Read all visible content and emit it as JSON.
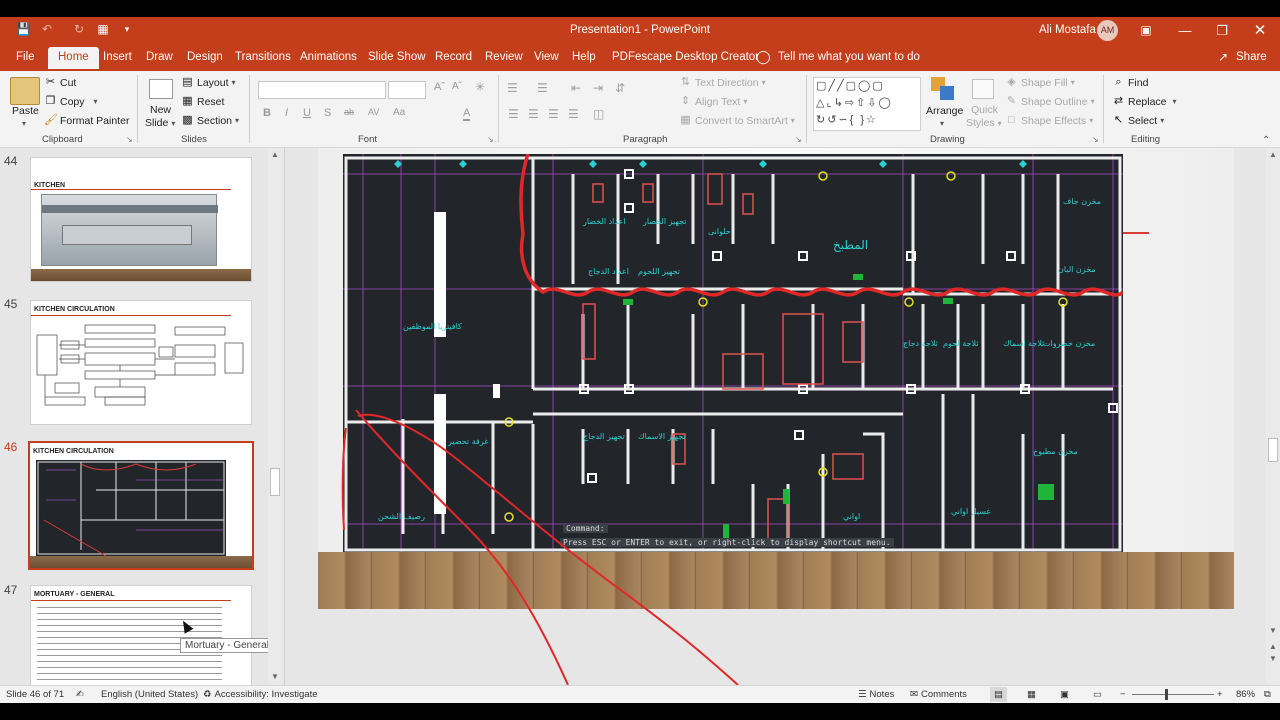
{
  "window": {
    "title": "Presentation1 - PowerPoint",
    "user_name": "Ali Mostafa",
    "user_initials": "AM"
  },
  "tabs": [
    "File",
    "Home",
    "Insert",
    "Draw",
    "Design",
    "Transitions",
    "Animations",
    "Slide Show",
    "Record",
    "Review",
    "View",
    "Help",
    "PDFescape Desktop Creator"
  ],
  "active_tab": "Home",
  "tell_me": "Tell me what you want to do",
  "share_label": "Share",
  "ribbon": {
    "clipboard": {
      "paste": "Paste",
      "cut": "Cut",
      "copy": "Copy",
      "format_painter": "Format Painter",
      "label": "Clipboard"
    },
    "slides": {
      "new_slide_1": "New",
      "new_slide_2": "Slide",
      "layout": "Layout",
      "reset": "Reset",
      "section": "Section",
      "label": "Slides"
    },
    "font": {
      "label": "Font",
      "buttons": [
        "B",
        "I",
        "U",
        "S",
        "ab",
        "AV",
        "Aa",
        "A"
      ]
    },
    "paragraph": {
      "label": "Paragraph",
      "text_direction": "Text Direction",
      "align_text": "Align Text",
      "convert_smartart": "Convert to SmartArt"
    },
    "drawing": {
      "label": "Drawing",
      "arrange": "Arrange",
      "quick_styles_1": "Quick",
      "quick_styles_2": "Styles",
      "shape_fill": "Shape Fill",
      "shape_outline": "Shape Outline",
      "shape_effects": "Shape Effects"
    },
    "editing": {
      "label": "Editing",
      "find": "Find",
      "replace": "Replace",
      "select": "Select"
    }
  },
  "thumbnails": [
    {
      "number": "44",
      "title": "KITCHEN"
    },
    {
      "number": "45",
      "title": "KITCHEN CIRCULATION"
    },
    {
      "number": "46",
      "title": "KITCHEN CIRCULATION",
      "selected": true
    },
    {
      "number": "47",
      "title": "MORTUARY - GENERAL"
    }
  ],
  "tooltip": "Mortuary - General",
  "cad": {
    "command_label": "Command:",
    "command_hint": "Press ESC or ENTER to exit, or right-click to display shortcut menu.",
    "rooms": [
      "المطبخ",
      "اعداد الخضار",
      "تجهيز الخضار",
      "حلوانى",
      "مخزن جاف",
      "مخزن البان",
      "اعداد الدجاج",
      "تجهيز اللحوم",
      "ثلاجة لحوم",
      "مخزن خضروات",
      "ثلاجة دجاج",
      "ثلاجة اسماك",
      "رصيف الشحن",
      "غرفة تحضير",
      "مخزن مطبوخ",
      "تجهيز الدجاج",
      "تجهيز الاسماك",
      "اواني",
      "غسيل اواني"
    ]
  },
  "status": {
    "slide": "Slide 46 of 71",
    "language": "English (United States)",
    "accessibility": "Accessibility: Investigate",
    "notes": "Notes",
    "comments": "Comments",
    "zoom": "86%"
  }
}
